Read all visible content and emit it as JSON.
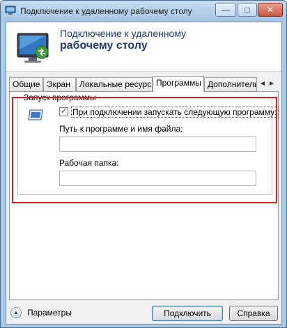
{
  "window": {
    "title": "Подключение к удаленному рабочему столу",
    "controls": {
      "minimize": "—",
      "maximize": "□",
      "close": "✕"
    }
  },
  "header": {
    "line1": "Подключение к удаленному",
    "line2": "рабочему столу"
  },
  "tabs": [
    {
      "label": "Общие",
      "active": false
    },
    {
      "label": "Экран",
      "active": false
    },
    {
      "label": "Локальные ресурсы",
      "active": false
    },
    {
      "label": "Программы",
      "active": true
    },
    {
      "label": "Дополнительно",
      "active": false
    }
  ],
  "tab_scroll": {
    "left": "◀",
    "right": "▶"
  },
  "programs": {
    "group_title": "Запуск программы",
    "start_program_checked": true,
    "check_mark": "✓",
    "start_program_label": "При подключении запускать следующую программу:",
    "path_label": "Путь к программе и имя файла:",
    "path_value": "",
    "folder_label": "Рабочая папка:",
    "folder_value": ""
  },
  "footer": {
    "options_arrow": "▲",
    "options_label": "Параметры",
    "connect_label": "Подключить",
    "help_label": "Справка"
  },
  "colors": {
    "highlight": "#d71f2a",
    "header_text": "#1e3a6e",
    "frame": "#a9c9e6"
  }
}
